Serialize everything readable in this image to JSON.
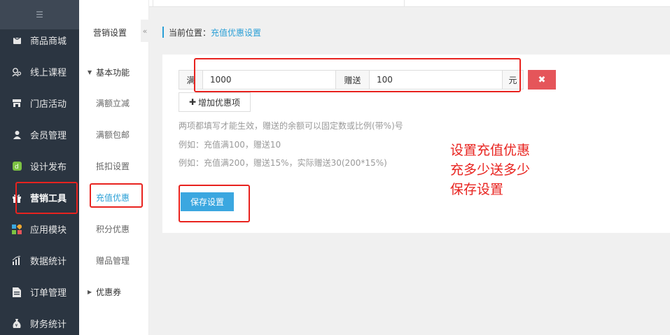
{
  "sidebar": {
    "toggle_glyph": "☰",
    "items": [
      {
        "label": "商品商城",
        "icon": "shop-icon"
      },
      {
        "label": "线上课程",
        "icon": "user-search-icon"
      },
      {
        "label": "门店活动",
        "icon": "store-icon"
      },
      {
        "label": "会员管理",
        "icon": "member-icon"
      },
      {
        "label": "设计发布",
        "icon": "design-icon"
      },
      {
        "label": "营销工具",
        "icon": "gift-icon",
        "active": true
      },
      {
        "label": "应用模块",
        "icon": "apps-icon"
      },
      {
        "label": "数据统计",
        "icon": "bar-chart-icon"
      },
      {
        "label": "订单管理",
        "icon": "order-icon"
      },
      {
        "label": "财务统计",
        "icon": "money-bag-icon"
      }
    ]
  },
  "subnav": {
    "title": "营销设置",
    "collapse_glyph": "«",
    "group_basic": "基本功能",
    "items": [
      "满额立减",
      "满额包邮",
      "抵扣设置",
      "充值优惠",
      "积分优惠",
      "赠品管理"
    ],
    "group_coupon": "优惠券"
  },
  "breadcrumb": {
    "prefix": "当前位置：",
    "current": "充值优惠设置"
  },
  "rule": {
    "full_label": "满",
    "full_value": "1000",
    "gift_label": "赠送",
    "gift_value": "100",
    "unit": "元",
    "delete_glyph": "✖"
  },
  "add_button": {
    "plus": "✚",
    "label": "增加优惠项"
  },
  "hints": [
    "两项都填写才能生效，赠送的余额可以固定数或比例(带%)号",
    "例如：充值满100，赠送10",
    "例如：充值满200，赠送15%，实际赠送30(200*15%)"
  ],
  "save_button": "保存设置",
  "annotation": {
    "line1": "设置充值优惠",
    "line2": "充多少送多少",
    "line3": "保存设置"
  },
  "colors": {
    "sidebar_bg": "#2b3541",
    "accent": "#2a9fd6",
    "danger": "#e5555a",
    "annotation_red": "#e8231f"
  }
}
